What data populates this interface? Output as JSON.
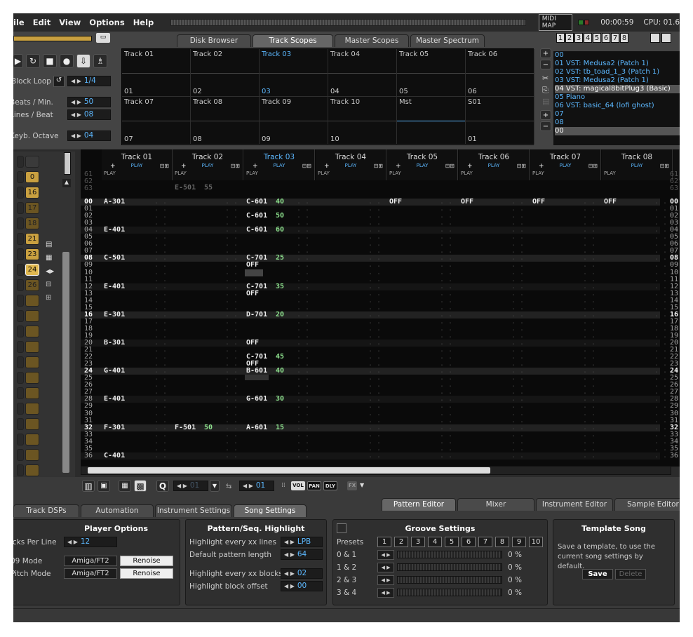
{
  "menu": [
    "ile",
    "Edit",
    "View",
    "Options",
    "Help"
  ],
  "status": {
    "midi_map": "MIDI MAP",
    "time": "00:00:59",
    "cpu": "CPU: 01.6"
  },
  "top_tabs": [
    "Disk Browser",
    "Track Scopes",
    "Master Scopes",
    "Master Spectrum"
  ],
  "active_top_tab": "Track Scopes",
  "layout_buttons": [
    "1",
    "2",
    "3",
    "4",
    "5",
    "6",
    "7",
    "8"
  ],
  "transport": {
    "block_loop_label": "Block Loop",
    "block_loop_value": "1/4",
    "bpm_label": "Beats / Min.",
    "bpm_value": "50",
    "lpb_label": "Lines / Beat",
    "lpb_value": "08",
    "octave_label": "Keyb. Octave",
    "octave_value": "04"
  },
  "scopes": [
    {
      "name": "Track 01",
      "num": "01"
    },
    {
      "name": "Track 02",
      "num": "02"
    },
    {
      "name": "Track 03",
      "num": "03"
    },
    {
      "name": "Track 04",
      "num": "04"
    },
    {
      "name": "Track 05",
      "num": "05"
    },
    {
      "name": "Track 06",
      "num": "06"
    },
    {
      "name": "Track 07",
      "num": "07"
    },
    {
      "name": "Track 08",
      "num": "08"
    },
    {
      "name": "Track 09",
      "num": "09"
    },
    {
      "name": "Track 10",
      "num": "10"
    },
    {
      "name": "Mst",
      "num": ""
    },
    {
      "name": "S01",
      "num": "01"
    }
  ],
  "instruments": [
    "00",
    "01 VST: Medusa2 (Patch   1)",
    "02 VST: tb_toad_1_3 (Patch   1)",
    "03 VST: Medusa2 (Patch   1)",
    "04 VST: magical8bitPlug3 (Basic)",
    "05 Piano",
    "06 VST: basic_64 (lofi ghost)",
    "07",
    "08",
    "00"
  ],
  "sequencer": {
    "pattern_count": "64",
    "slots": [
      "0",
      "16",
      "17",
      "18",
      "21",
      "23",
      "24",
      "26"
    ]
  },
  "pattern": {
    "tracks": [
      "Track 01",
      "Track 02",
      "Track 03",
      "Track 04",
      "Track 05",
      "Track 06",
      "Track 07",
      "Track 08"
    ],
    "play": "PLAY",
    "pre_rows": [
      "61",
      "62",
      "63"
    ],
    "rows": [
      "00",
      "01",
      "02",
      "03",
      "04",
      "05",
      "06",
      "07",
      "08",
      "09",
      "10",
      "11",
      "12",
      "13",
      "14",
      "15",
      "16",
      "17",
      "18",
      "19",
      "20",
      "21",
      "22",
      "23",
      "24",
      "25",
      "26",
      "27",
      "28",
      "29",
      "30",
      "31",
      "32",
      "33",
      "34",
      "35",
      "36"
    ],
    "notes": [
      {
        "t": 0,
        "r": 0,
        "n": "A-301",
        "v": ""
      },
      {
        "t": 0,
        "r": 4,
        "n": "E-401",
        "v": ""
      },
      {
        "t": 0,
        "r": 8,
        "n": "C-501",
        "v": ""
      },
      {
        "t": 0,
        "r": 12,
        "n": "E-401",
        "v": ""
      },
      {
        "t": 0,
        "r": 16,
        "n": "E-301",
        "v": ""
      },
      {
        "t": 0,
        "r": 20,
        "n": "B-301",
        "v": ""
      },
      {
        "t": 0,
        "r": 24,
        "n": "G-401",
        "v": ""
      },
      {
        "t": 0,
        "r": 28,
        "n": "E-401",
        "v": ""
      },
      {
        "t": 0,
        "r": 32,
        "n": "F-301",
        "v": ""
      },
      {
        "t": 0,
        "r": 36,
        "n": "C-401",
        "v": ""
      },
      {
        "t": 1,
        "r": -2,
        "n": "E-501",
        "v": "55"
      },
      {
        "t": 1,
        "r": 32,
        "n": "F-501",
        "v": "50"
      },
      {
        "t": 2,
        "r": 0,
        "n": "C-601",
        "v": "40"
      },
      {
        "t": 2,
        "r": 2,
        "n": "C-601",
        "v": "50"
      },
      {
        "t": 2,
        "r": 4,
        "n": "C-601",
        "v": "60"
      },
      {
        "t": 2,
        "r": 8,
        "n": "C-701",
        "v": "25"
      },
      {
        "t": 2,
        "r": 9,
        "n": "OFF",
        "v": ""
      },
      {
        "t": 2,
        "r": 12,
        "n": "C-701",
        "v": "35"
      },
      {
        "t": 2,
        "r": 13,
        "n": "OFF",
        "v": ""
      },
      {
        "t": 2,
        "r": 16,
        "n": "D-701",
        "v": "20"
      },
      {
        "t": 2,
        "r": 20,
        "n": "OFF",
        "v": ""
      },
      {
        "t": 2,
        "r": 22,
        "n": "C-701",
        "v": "45"
      },
      {
        "t": 2,
        "r": 23,
        "n": "OFF",
        "v": ""
      },
      {
        "t": 2,
        "r": 24,
        "n": "B-601",
        "v": "40"
      },
      {
        "t": 2,
        "r": 28,
        "n": "G-601",
        "v": "30"
      },
      {
        "t": 2,
        "r": 32,
        "n": "A-601",
        "v": "15"
      },
      {
        "t": 4,
        "r": 0,
        "n": "OFF",
        "v": ""
      },
      {
        "t": 5,
        "r": 0,
        "n": "OFF",
        "v": ""
      },
      {
        "t": 6,
        "r": 0,
        "n": "OFF",
        "v": ""
      },
      {
        "t": 7,
        "r": 0,
        "n": "OFF",
        "v": ""
      }
    ]
  },
  "bottom_toolbar": {
    "instr": "01",
    "edit_step": "01",
    "vol": "VOL",
    "pan": "PAN",
    "dly": "DLY",
    "fx": "FX"
  },
  "bottom_tabs": [
    "Track DSPs",
    "Automation",
    "Instrument Settings",
    "Song Settings"
  ],
  "active_bottom_tab": "Song Settings",
  "editor_tabs": [
    "Pattern Editor",
    "Mixer",
    "Instrument Editor",
    "Sample Editor"
  ],
  "player_options": {
    "title": "Player Options",
    "tpl_label": "icks Per Line",
    "tpl_value": "12",
    "mode_label": "09 Mode",
    "pitch_label": "Pitch Mode",
    "aft": "Amiga/FT2",
    "ren": "Renoise"
  },
  "highlight": {
    "title": "Pattern/Seq. Highlight",
    "hl_lines_label": "Highlight every xx lines",
    "hl_lines_value": "LPB",
    "pat_len_label": "Default pattern length",
    "pat_len_value": "64",
    "hl_blocks_label": "Highlight every xx blocks",
    "hl_blocks_value": "02",
    "hl_offset_label": "Highlight block offset",
    "hl_offset_value": "00"
  },
  "groove": {
    "title": "Groove Settings",
    "presets_label": "Presets",
    "presets": [
      "1",
      "2",
      "3",
      "4",
      "5",
      "6",
      "7",
      "8",
      "9",
      "10"
    ],
    "rows": [
      {
        "label": "0 & 1",
        "value": "0 %"
      },
      {
        "label": "1 & 2",
        "value": "0 %"
      },
      {
        "label": "2 & 3",
        "value": "0 %"
      },
      {
        "label": "3 & 4",
        "value": "0 %"
      }
    ]
  },
  "template": {
    "title": "Template Song",
    "desc": "Save a template, to use the current song settings by default.",
    "save": "Save",
    "delete": "Delete"
  }
}
